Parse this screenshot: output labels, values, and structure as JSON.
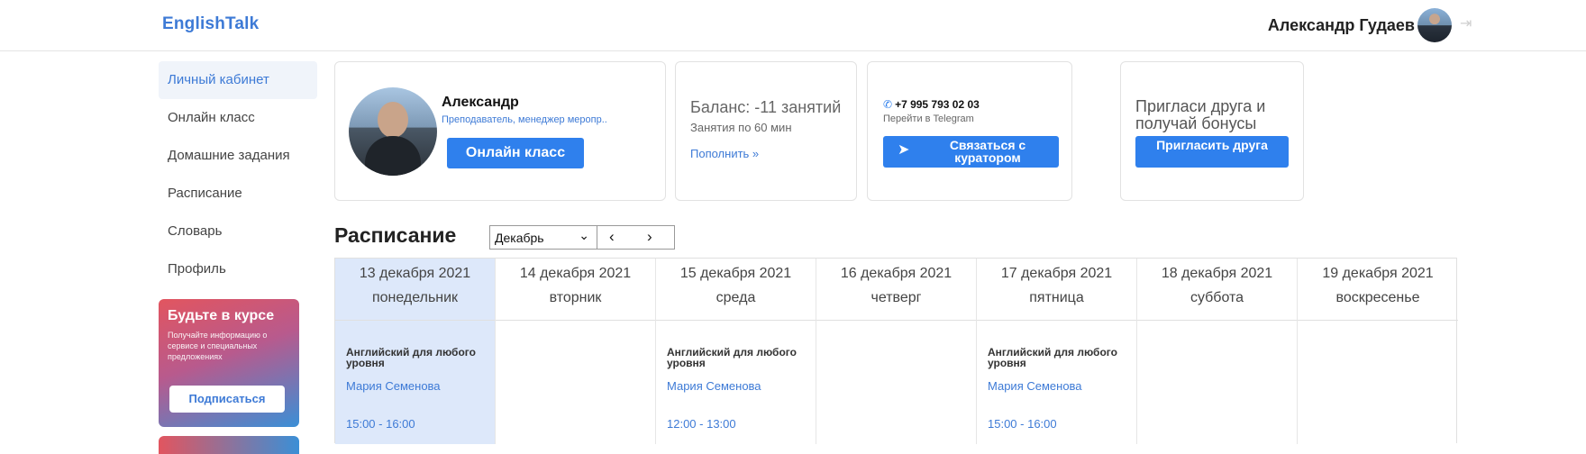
{
  "header": {
    "logo": "EnglishTalk",
    "user_name": "Александр Гудаев"
  },
  "sidebar": {
    "items": [
      {
        "label": "Личный кабинет",
        "active": true
      },
      {
        "label": "Онлайн класс"
      },
      {
        "label": "Домашние задания"
      },
      {
        "label": "Расписание"
      },
      {
        "label": "Словарь"
      },
      {
        "label": "Профиль"
      }
    ],
    "promo": {
      "title": "Будьте в курсе",
      "text": "Получайте информацию о сервисе и специальных предложениях",
      "button": "Подписаться"
    }
  },
  "profile_card": {
    "name": "Александр",
    "role": "Преподаватель, менеджер меропр..",
    "button": "Онлайн класс"
  },
  "balance_card": {
    "title": "Баланс: -11 занятий",
    "subtitle": "Занятия по 60 мин",
    "link": "Пополнить »"
  },
  "contact_card": {
    "phone": "+7 995 793 02 03",
    "subtitle": "Перейти в Telegram",
    "button": "Связаться с куратором"
  },
  "invite_card": {
    "title": "Пригласи друга и получай бонусы",
    "button": "Пригласить друга"
  },
  "schedule": {
    "title": "Расписание",
    "month": "Декабрь",
    "prev": "‹",
    "next": "›",
    "days": [
      {
        "date": "13 декабря 2021",
        "weekday": "понедельник",
        "highlight": true,
        "lesson": {
          "name": "Английский для любого уровня",
          "teacher": "Мария Семенова",
          "time": "15:00 - 16:00"
        }
      },
      {
        "date": "14 декабря 2021",
        "weekday": "вторник"
      },
      {
        "date": "15 декабря 2021",
        "weekday": "среда",
        "lesson": {
          "name": "Английский для любого уровня",
          "teacher": "Мария Семенова",
          "time": "12:00 - 13:00"
        }
      },
      {
        "date": "16 декабря 2021",
        "weekday": "четверг"
      },
      {
        "date": "17 декабря 2021",
        "weekday": "пятница",
        "lesson": {
          "name": "Английский для любого уровня",
          "teacher": "Мария Семенова",
          "time": "15:00 - 16:00"
        }
      },
      {
        "date": "18 декабря 2021",
        "weekday": "суббота"
      },
      {
        "date": "19 декабря 2021",
        "weekday": "воскресенье"
      }
    ]
  },
  "icons": {
    "logout": "logout-icon",
    "phone": "phone-icon",
    "telegram": "telegram-plane-icon",
    "chevron": "chevron-down-icon"
  },
  "colors": {
    "accent": "#2f80ed",
    "link": "#3d7ad6",
    "highlight_column": "#dde8fa"
  }
}
